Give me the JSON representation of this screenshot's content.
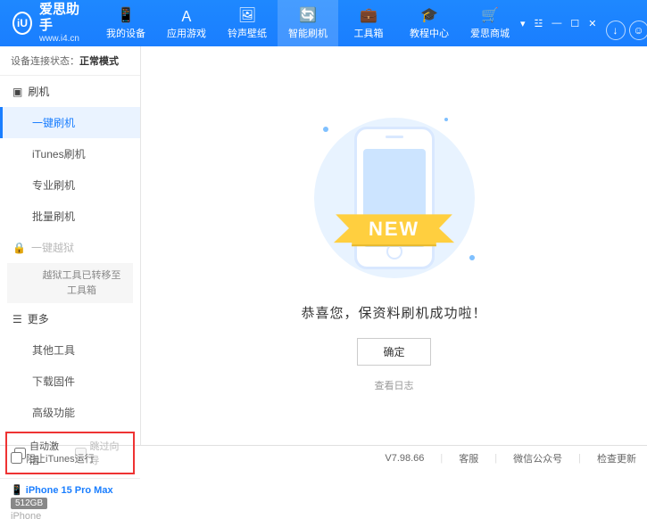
{
  "brand": {
    "title": "爱思助手",
    "url": "www.i4.cn",
    "logo_letter": "iU"
  },
  "nav": [
    {
      "label": "我的设备",
      "icon": "📱"
    },
    {
      "label": "应用游戏",
      "icon": "Ａ"
    },
    {
      "label": "铃声壁纸",
      "icon": "🖼"
    },
    {
      "label": "智能刷机",
      "icon": "🔄"
    },
    {
      "label": "工具箱",
      "icon": "💼"
    },
    {
      "label": "教程中心",
      "icon": "🎓"
    },
    {
      "label": "爱思商城",
      "icon": "🛒"
    }
  ],
  "status": {
    "prefix": "设备连接状态：",
    "value": "正常模式"
  },
  "sidebar": {
    "flash": {
      "title": "刷机",
      "items": [
        "一键刷机",
        "iTunes刷机",
        "专业刷机",
        "批量刷机"
      ]
    },
    "jailbreak": {
      "title": "一键越狱",
      "note": "越狱工具已转移至\n工具箱"
    },
    "more": {
      "title": "更多",
      "items": [
        "其他工具",
        "下载固件",
        "高级功能"
      ]
    }
  },
  "options": {
    "auto_activate": "自动激活",
    "skip_guide": "跳过向导"
  },
  "device": {
    "name": "iPhone 15 Pro Max",
    "storage": "512GB",
    "type": "iPhone"
  },
  "main": {
    "ribbon": "NEW",
    "success": "恭喜您，保资料刷机成功啦！",
    "ok": "确定",
    "view_log": "查看日志"
  },
  "footer": {
    "block_itunes": "阻止iTunes运行",
    "version": "V7.98.66",
    "links": [
      "客服",
      "微信公众号",
      "检查更新"
    ]
  }
}
